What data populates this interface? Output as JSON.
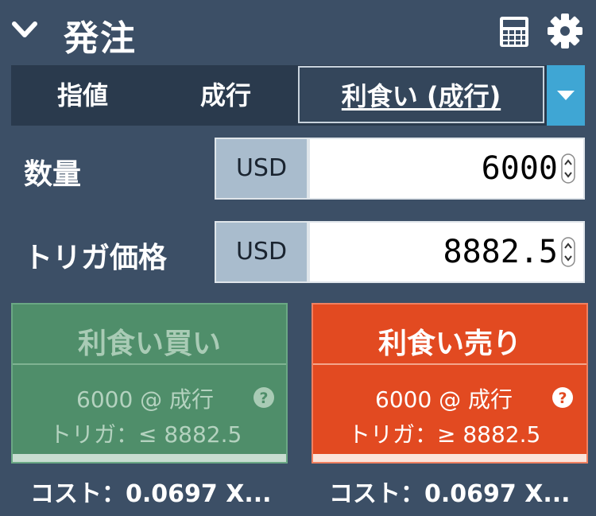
{
  "header": {
    "title": "発注",
    "collapse_icon": "chevron-down-icon",
    "calculator_icon": "calculator-icon",
    "settings_icon": "gear-icon"
  },
  "tabs": [
    {
      "label": "指値",
      "selected": false
    },
    {
      "label": "成行",
      "selected": false
    },
    {
      "label": "利食い (成行)",
      "selected": true
    }
  ],
  "tab_dropdown_icon": "caret-down-icon",
  "quantity": {
    "label": "数量",
    "unit": "USD",
    "value": "6000"
  },
  "trigger_price": {
    "label": "トリガ価格",
    "unit": "USD",
    "value": "8882.5"
  },
  "buy": {
    "title": "利食い買い",
    "detail": "6000 @ 成行",
    "trigger": "トリガ：≤ 8882.5",
    "cost": "コスト：0.0697 X...",
    "enabled": false
  },
  "sell": {
    "title": "利食い売り",
    "detail": "6000 @ 成行",
    "trigger": "トリガ：≥ 8882.5",
    "cost": "コスト：0.0697 X...",
    "enabled": true
  },
  "colors": {
    "panel_bg": "#3c4f66",
    "tab_bg": "#2a3a4d",
    "accent_blue": "#3fa6d4",
    "buy_green": "#4f8e6a",
    "sell_orange": "#e24a21",
    "unit_bg": "#a9bccd"
  }
}
